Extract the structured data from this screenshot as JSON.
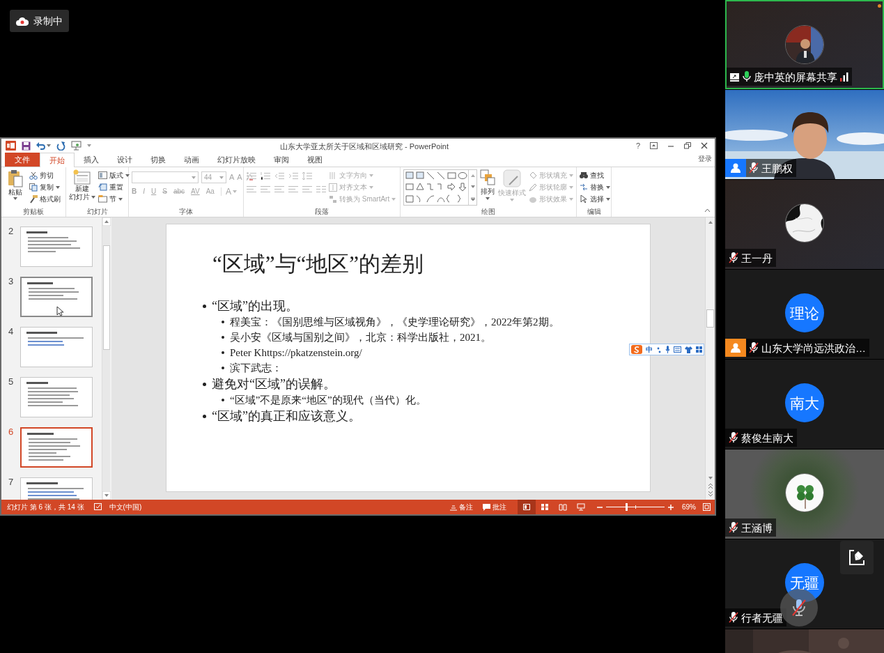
{
  "recording": {
    "label": "录制中"
  },
  "powerpoint": {
    "title": "山东大学亚太所关于区域和区域研究 - PowerPoint",
    "help": "?",
    "sign_in": "登录",
    "tabs": [
      {
        "label": "文件",
        "kind": "file",
        "selected": false
      },
      {
        "label": "开始",
        "kind": "tab",
        "selected": true
      },
      {
        "label": "插入",
        "kind": "tab",
        "selected": false
      },
      {
        "label": "设计",
        "kind": "tab",
        "selected": false
      },
      {
        "label": "切换",
        "kind": "tab",
        "selected": false
      },
      {
        "label": "动画",
        "kind": "tab",
        "selected": false
      },
      {
        "label": "幻灯片放映",
        "kind": "tab",
        "selected": false
      },
      {
        "label": "审阅",
        "kind": "tab",
        "selected": false
      },
      {
        "label": "视图",
        "kind": "tab",
        "selected": false
      }
    ],
    "ribbon": {
      "clipboard": {
        "label": "剪贴板",
        "paste": "粘贴",
        "items": [
          "剪切",
          "复制",
          "格式刷"
        ]
      },
      "slides": {
        "label": "幻灯片",
        "new_slide": [
          "新建",
          "幻灯片"
        ],
        "items": [
          "版式",
          "重置",
          "节"
        ]
      },
      "font": {
        "label": "字体",
        "disabled": true,
        "size": "44",
        "grow_shrink": [
          "A",
          "A"
        ],
        "format_buttons": [
          "B",
          "I",
          "U",
          "S",
          "abc",
          "AV",
          "Aa"
        ],
        "color_button": "A"
      },
      "paragraph": {
        "label": "段落",
        "disabled": true,
        "items": [
          "文字方向",
          "对齐文本",
          "转换为 SmartArt"
        ]
      },
      "drawing": {
        "label": "绘图",
        "arrange": {
          "label": "排列",
          "disabled": false
        },
        "quick_styles": {
          "label": "快速样式",
          "disabled": true
        },
        "items": [
          {
            "label": "形状填充",
            "disabled": true
          },
          {
            "label": "形状轮廓",
            "disabled": true
          },
          {
            "label": "形状效果",
            "disabled": true
          }
        ]
      },
      "editing": {
        "label": "编辑",
        "items": [
          "查找",
          "替换",
          "选择"
        ]
      }
    },
    "thumbnails": [
      {
        "number": "2",
        "selected": false,
        "hovered": false
      },
      {
        "number": "3",
        "selected": false,
        "hovered": true
      },
      {
        "number": "4",
        "selected": false,
        "hovered": false
      },
      {
        "number": "5",
        "selected": false,
        "hovered": false
      },
      {
        "number": "6",
        "selected": true,
        "hovered": false
      },
      {
        "number": "7",
        "selected": false,
        "hovered": false
      }
    ],
    "slide": {
      "title": "“区域”与“地区”的差别",
      "bullets": [
        {
          "text": "“区域”的出现。",
          "children": [
            {
              "text": "程美宝：《国别思维与区域视角》，《史学理论研究》，2022年第2期。"
            },
            {
              "text": "吴小安《区域与国别之间》，北京：科学出版社，2021。"
            },
            {
              "text": "Peter Khttps://pkatzenstein.org/"
            },
            {
              "text": "滨下武志："
            }
          ]
        },
        {
          "text": "避免对“区域”的误解。",
          "children": [
            {
              "text": "“区域”不是原来“地区”的现代（当代）化。"
            }
          ]
        },
        {
          "text": "“区域”的真正和应该意义。"
        }
      ]
    },
    "ime": {
      "mode": "中"
    },
    "status_bar": {
      "slide_info": "幻灯片 第 6 张，共 14 张",
      "language": "中文(中国)",
      "notes": "备注",
      "comments": "批注",
      "views": [
        {
          "selected": true
        },
        {
          "selected": false
        },
        {
          "selected": false
        },
        {
          "selected": false
        }
      ],
      "zoom": {
        "level": 0.33
      },
      "zoom_label": "69%"
    }
  },
  "participants": [
    {
      "name": "庞中英的屏幕共享",
      "active": true,
      "mic_on": true,
      "sharing": true
    },
    {
      "name": "王鹏权",
      "kind": "video",
      "active": false,
      "mic_on": false,
      "sharing": false,
      "color": "#1677ff"
    },
    {
      "name": "王一丹",
      "active": false,
      "mic_on": false,
      "sharing": false
    },
    {
      "name": "山东大学尚远洪政治…",
      "kind": "initials",
      "avatar_text": "理论",
      "active": false,
      "mic_on": false,
      "sharing": false,
      "color": "#f5891f"
    },
    {
      "name": "蔡俊生南大",
      "kind": "initials",
      "avatar_text": "南大",
      "active": false,
      "mic_on": false,
      "sharing": false
    },
    {
      "name": "王涵博",
      "active": false,
      "mic_on": false,
      "sharing": false
    },
    {
      "name": "行者无疆",
      "kind": "initials",
      "avatar_text": "无疆",
      "active": false,
      "mic_on": false,
      "sharing": false
    }
  ]
}
